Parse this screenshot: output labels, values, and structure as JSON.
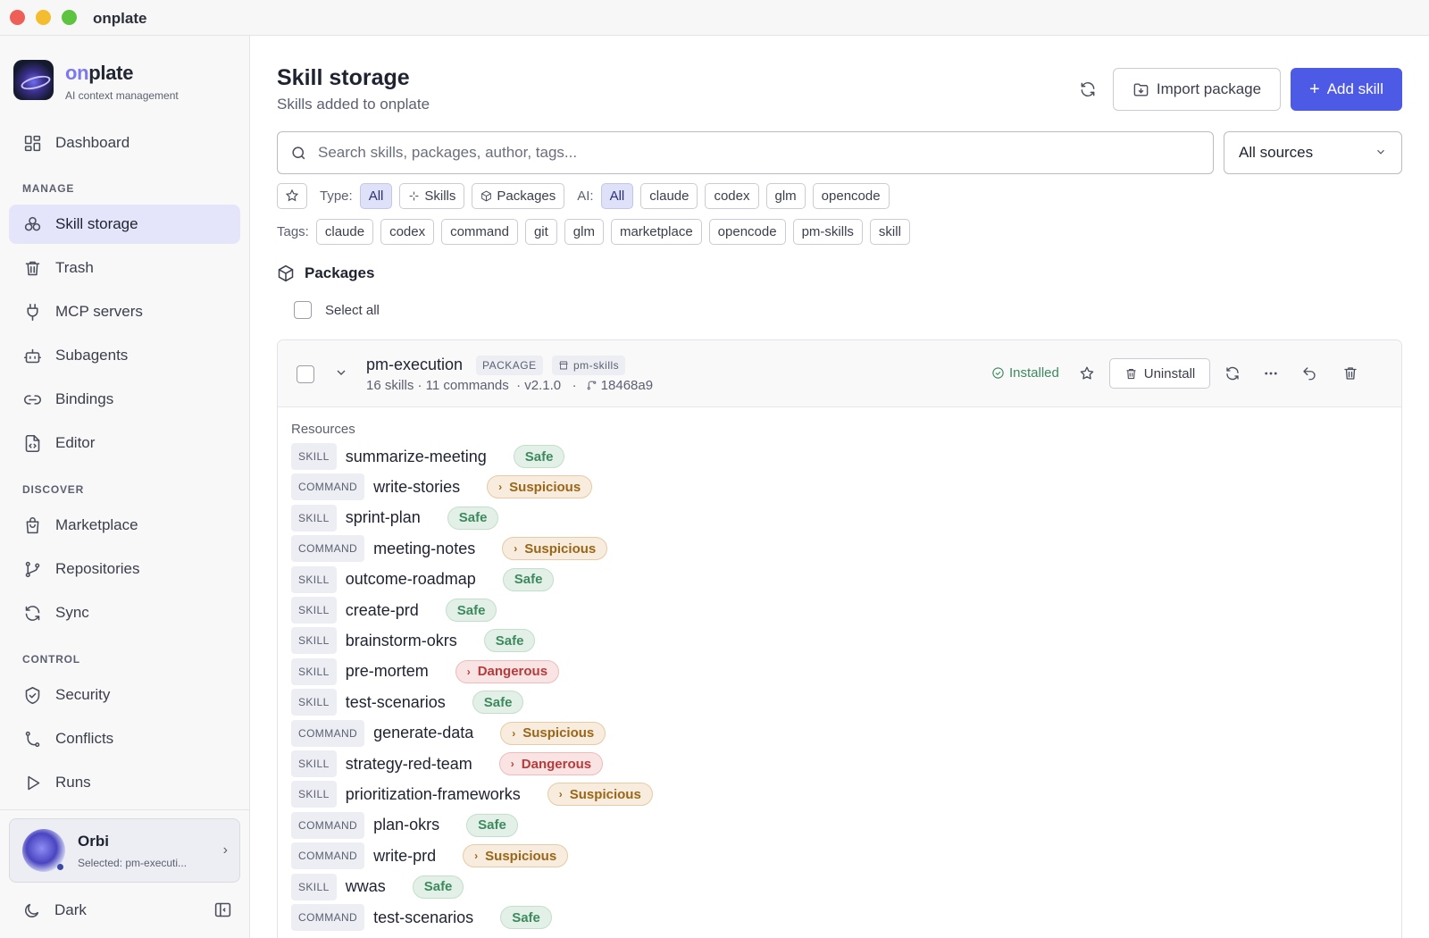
{
  "window": {
    "title": "onplate"
  },
  "brand": {
    "prefix": "on",
    "suffix": "plate",
    "subtitle": "AI context management"
  },
  "sidebar": {
    "dashboard": "Dashboard",
    "sections": {
      "manage": "MANAGE",
      "discover": "DISCOVER",
      "control": "CONTROL"
    },
    "manage": [
      "Skill storage",
      "Trash",
      "MCP servers",
      "Subagents",
      "Bindings",
      "Editor"
    ],
    "discover": [
      "Marketplace",
      "Repositories",
      "Sync"
    ],
    "control": [
      "Security",
      "Conflicts",
      "Runs"
    ],
    "active_item": "Skill storage",
    "orbi": {
      "name": "Orbi",
      "selected": "Selected: pm-executi..."
    },
    "theme_label": "Dark"
  },
  "header": {
    "title": "Skill storage",
    "subtitle": "Skills added to onplate",
    "import_label": "Import package",
    "add_label": "Add skill"
  },
  "search": {
    "placeholder": "Search skills, packages, author, tags...",
    "value": ""
  },
  "source_select": {
    "value": "All sources"
  },
  "filters": {
    "type_label": "Type:",
    "type_options": [
      "All",
      "Skills",
      "Packages"
    ],
    "ai_label": "AI:",
    "ai_options": [
      "All",
      "claude",
      "codex",
      "glm",
      "opencode"
    ],
    "tags_label": "Tags:",
    "tags": [
      "claude",
      "codex",
      "command",
      "git",
      "glm",
      "marketplace",
      "opencode",
      "pm-skills",
      "skill"
    ]
  },
  "packages": {
    "heading": "Packages",
    "select_all": "Select all",
    "item": {
      "name": "pm-execution",
      "kind_tag": "PACKAGE",
      "source_tag": "pm-skills",
      "counts": "16 skills · 11 commands",
      "version": "· v2.1.0",
      "sep": "·",
      "commit": "18468a9",
      "status": "Installed",
      "uninstall_label": "Uninstall",
      "resources_label": "Resources",
      "resources": [
        {
          "kind": "SKILL",
          "name": "summarize-meeting",
          "status": "Safe",
          "level": "safe"
        },
        {
          "kind": "COMMAND",
          "name": "write-stories",
          "status": "Suspicious",
          "level": "suspicious"
        },
        {
          "kind": "SKILL",
          "name": "sprint-plan",
          "status": "Safe",
          "level": "safe"
        },
        {
          "kind": "COMMAND",
          "name": "meeting-notes",
          "status": "Suspicious",
          "level": "suspicious"
        },
        {
          "kind": "SKILL",
          "name": "outcome-roadmap",
          "status": "Safe",
          "level": "safe"
        },
        {
          "kind": "SKILL",
          "name": "create-prd",
          "status": "Safe",
          "level": "safe"
        },
        {
          "kind": "SKILL",
          "name": "brainstorm-okrs",
          "status": "Safe",
          "level": "safe"
        },
        {
          "kind": "SKILL",
          "name": "pre-mortem",
          "status": "Dangerous",
          "level": "dangerous"
        },
        {
          "kind": "SKILL",
          "name": "test-scenarios",
          "status": "Safe",
          "level": "safe"
        },
        {
          "kind": "COMMAND",
          "name": "generate-data",
          "status": "Suspicious",
          "level": "suspicious"
        },
        {
          "kind": "SKILL",
          "name": "strategy-red-team",
          "status": "Dangerous",
          "level": "dangerous"
        },
        {
          "kind": "SKILL",
          "name": "prioritization-frameworks",
          "status": "Suspicious",
          "level": "suspicious"
        },
        {
          "kind": "COMMAND",
          "name": "plan-okrs",
          "status": "Safe",
          "level": "safe"
        },
        {
          "kind": "COMMAND",
          "name": "write-prd",
          "status": "Suspicious",
          "level": "suspicious"
        },
        {
          "kind": "SKILL",
          "name": "wwas",
          "status": "Safe",
          "level": "safe"
        },
        {
          "kind": "COMMAND",
          "name": "test-scenarios",
          "status": "Safe",
          "level": "safe"
        }
      ]
    }
  },
  "colors": {
    "accent": "#4d5ae6",
    "safe": "#3d8a5e",
    "suspicious": "#9a6618",
    "dangerous": "#b43c3c"
  }
}
